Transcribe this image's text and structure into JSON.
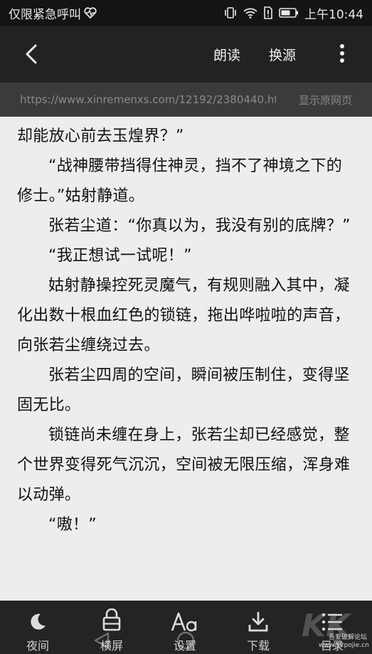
{
  "status_bar": {
    "emergency_text": "仅限紧急呼叫",
    "time": "上午10:44",
    "icons": [
      "heart-pulse-icon",
      "vibrate-icon",
      "wifi-icon",
      "sim-alert-icon",
      "battery-icon"
    ]
  },
  "top_bar": {
    "back_icon": "chevron-left-icon",
    "read_aloud_label": "朗读",
    "change_source_label": "换源",
    "more_icon": "more-vertical-icon"
  },
  "url_bar": {
    "url": "https://www.xinremenxs.com/12192/2380440.ht...",
    "show_original_label": "显示原网页"
  },
  "content": {
    "paragraphs": [
      {
        "text": "却能放心前去玉煌界？”",
        "indent": false
      },
      {
        "text": "“战神腰带挡得住神灵，挡不了神境之下的修士。”姑射静道。",
        "indent": true
      },
      {
        "text": "张若尘道：“你真以为，我没有别的底牌？”",
        "indent": true
      },
      {
        "text": "“我正想试一试呢！”",
        "indent": true
      },
      {
        "text": "姑射静操控死灵魔气，有规则融入其中，凝化出数十根血红色的锁链，拖出哗啦啦的声音，向张若尘缠绕过去。",
        "indent": true
      },
      {
        "text": "张若尘四周的空间，瞬间被压制住，变得坚固无比。",
        "indent": true
      },
      {
        "text": "锁链尚未缠在身上，张若尘却已经感觉，整个世界变得死气沉沉，空间被无限压缩，浑身难以动弹。",
        "indent": true
      },
      {
        "text": "“嗷！”",
        "indent": true
      }
    ]
  },
  "bottom_bar": {
    "items": [
      {
        "label": "夜间",
        "icon": "moon-icon"
      },
      {
        "label": "横屏",
        "icon": "rotate-lock-icon"
      },
      {
        "label": "设置",
        "icon": "font-settings-icon"
      },
      {
        "label": "下载",
        "icon": "download-icon"
      },
      {
        "label": "目录",
        "icon": "list-icon"
      }
    ]
  },
  "watermark": {
    "line1": "吾爱破解论坛",
    "line2": "www.52pojie.cn",
    "logo": "KK"
  },
  "colors": {
    "reader_bg": "#ededed",
    "toolbar_bg": "#222222",
    "url_bar_bg": "#3b3b3b",
    "text": "#111111"
  }
}
